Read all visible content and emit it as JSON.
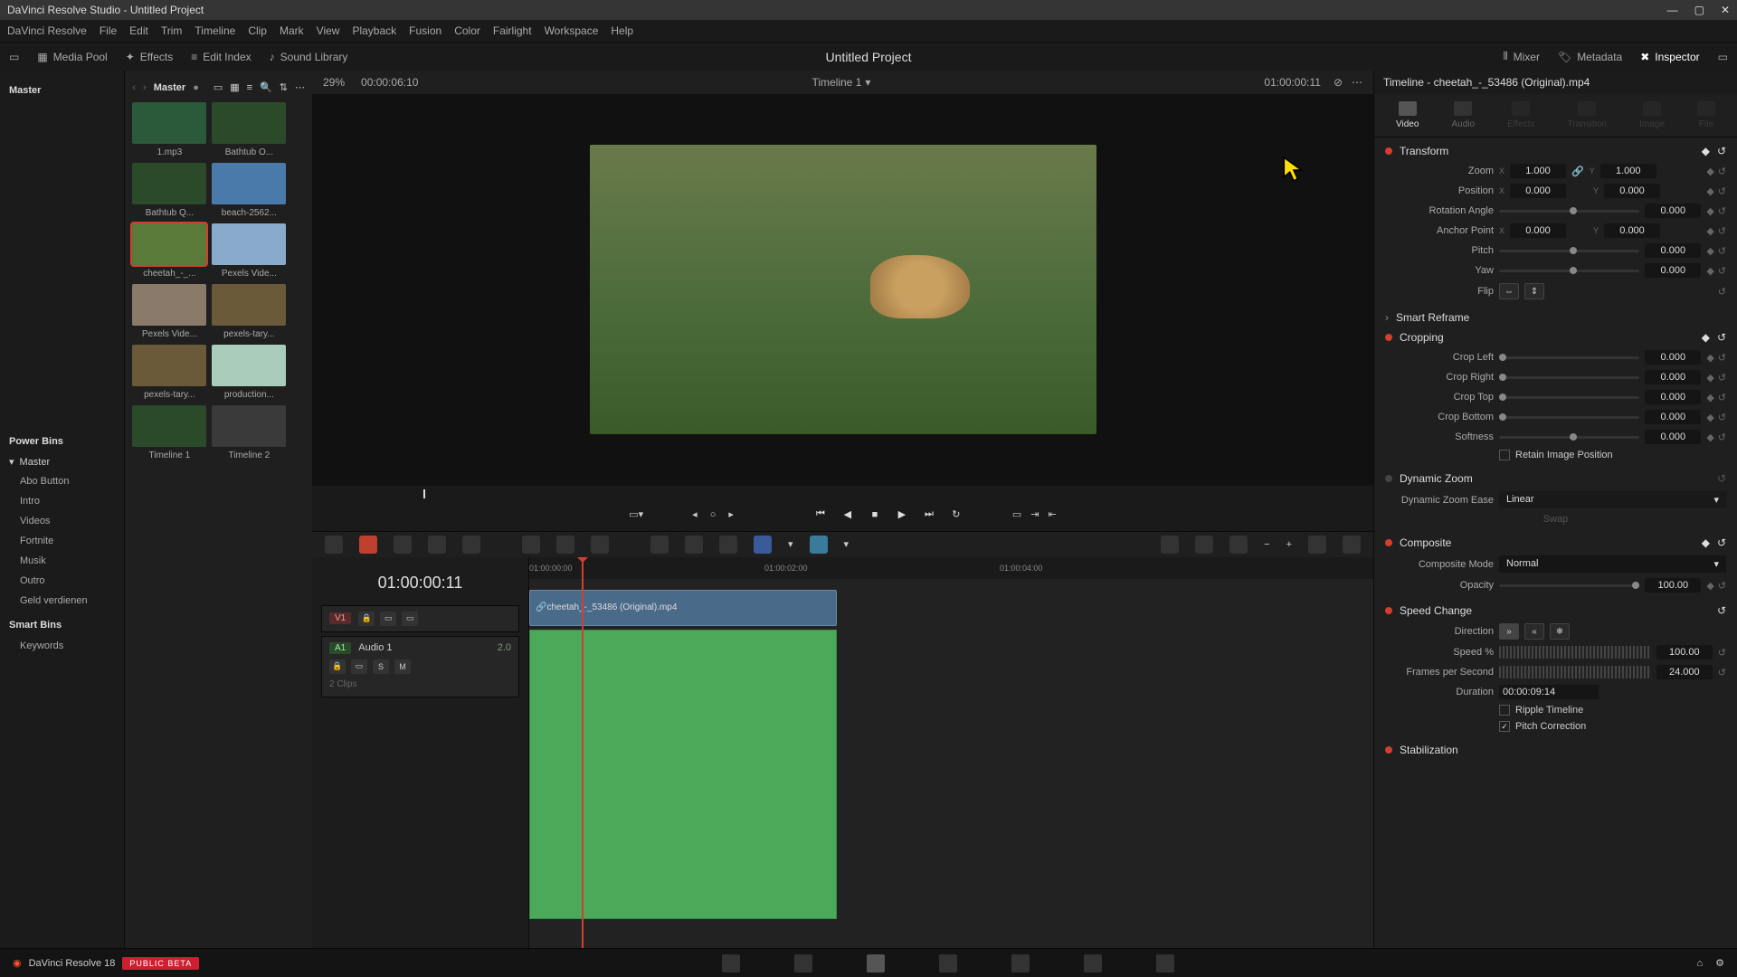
{
  "window": {
    "title": "DaVinci Resolve Studio - Untitled Project"
  },
  "menu": [
    "DaVinci Resolve",
    "File",
    "Edit",
    "Trim",
    "Timeline",
    "Clip",
    "Mark",
    "View",
    "Playback",
    "Fusion",
    "Color",
    "Fairlight",
    "Workspace",
    "Help"
  ],
  "toolbar": {
    "mediaPool": "Media Pool",
    "effects": "Effects",
    "editIndex": "Edit Index",
    "soundLibrary": "Sound Library",
    "projectTitle": "Untitled Project",
    "mixer": "Mixer",
    "metadata": "Metadata",
    "inspector": "Inspector"
  },
  "mediaPool": {
    "root": "Master",
    "breadcrumb": "Master",
    "clips": [
      {
        "name": "1.mp3",
        "sel": false,
        "hue": "#2a5a3a"
      },
      {
        "name": "Bathtub O...",
        "sel": false,
        "hue": "#2a4a2a"
      },
      {
        "name": "Bathtub Q...",
        "sel": false,
        "hue": "#2a4a2a"
      },
      {
        "name": "beach-2562...",
        "sel": false,
        "hue": "#4a7aaa"
      },
      {
        "name": "cheetah_-_...",
        "sel": true,
        "hue": "#5a7a3a"
      },
      {
        "name": "Pexels Vide...",
        "sel": false,
        "hue": "#8aaacc"
      },
      {
        "name": "Pexels Vide...",
        "sel": false,
        "hue": "#8a7a6a"
      },
      {
        "name": "pexels-tary...",
        "sel": false,
        "hue": "#6a5a3a"
      },
      {
        "name": "pexels-tary...",
        "sel": false,
        "hue": "#6a5a3a"
      },
      {
        "name": "production...",
        "sel": false,
        "hue": "#aaccbb"
      },
      {
        "name": "Timeline 1",
        "sel": false,
        "hue": "#2a4a2a"
      },
      {
        "name": "Timeline 2",
        "sel": false,
        "hue": "#3a3a3a"
      }
    ]
  },
  "bins": {
    "powerTitle": "Power Bins",
    "smartTitle": "Smart Bins",
    "master": "Master",
    "items": [
      "Abo Button",
      "Intro",
      "Videos",
      "Fortnite",
      "Musik",
      "Outro",
      "Geld verdienen"
    ],
    "smart": [
      "Keywords"
    ]
  },
  "viewer": {
    "zoom": "29%",
    "srcTC": "00:00:06:10",
    "timelineName": "Timeline 1",
    "recTC": "01:00:00:11"
  },
  "timeline": {
    "tc": "01:00:00:11",
    "ticks": [
      "01:00:00:00",
      "01:00:02:00",
      "01:00:04:00"
    ],
    "vTrack": "V1",
    "aTrack": "A1",
    "aLabel": "Audio 1",
    "aMeter": "2.0",
    "clipsLabel": "2 Clips",
    "clipName": "cheetah_-_53486 (Original).mp4"
  },
  "inspector": {
    "header": "Timeline - cheetah_-_53486 (Original).mp4",
    "tabs": [
      "Video",
      "Audio",
      "Effects",
      "Transition",
      "Image",
      "File"
    ],
    "transform": {
      "title": "Transform",
      "zoom": {
        "label": "Zoom",
        "x": "1.000",
        "y": "1.000"
      },
      "position": {
        "label": "Position",
        "x": "0.000",
        "y": "0.000"
      },
      "rotation": {
        "label": "Rotation Angle",
        "val": "0.000"
      },
      "anchor": {
        "label": "Anchor Point",
        "x": "0.000",
        "y": "0.000"
      },
      "pitch": {
        "label": "Pitch",
        "val": "0.000"
      },
      "yaw": {
        "label": "Yaw",
        "val": "0.000"
      },
      "flip": "Flip"
    },
    "smartReframe": "Smart Reframe",
    "cropping": {
      "title": "Cropping",
      "left": {
        "label": "Crop Left",
        "val": "0.000"
      },
      "right": {
        "label": "Crop Right",
        "val": "0.000"
      },
      "top": {
        "label": "Crop Top",
        "val": "0.000"
      },
      "bottom": {
        "label": "Crop Bottom",
        "val": "0.000"
      },
      "softness": {
        "label": "Softness",
        "val": "0.000"
      },
      "retain": "Retain Image Position"
    },
    "dynamicZoom": {
      "title": "Dynamic Zoom",
      "ease": "Dynamic Zoom Ease",
      "easeVal": "Linear",
      "swap": "Swap"
    },
    "composite": {
      "title": "Composite",
      "mode": "Composite Mode",
      "modeVal": "Normal",
      "opacity": "Opacity",
      "opacityVal": "100.00"
    },
    "speed": {
      "title": "Speed Change",
      "direction": "Direction",
      "speed": "Speed %",
      "speedVal": "100.00",
      "fps": "Frames per Second",
      "fpsVal": "24.000",
      "duration": "Duration",
      "durationVal": "00:00:09:14",
      "ripple": "Ripple Timeline",
      "pitch": "Pitch Correction"
    },
    "stabilization": "Stabilization"
  },
  "bottom": {
    "app": "DaVinci Resolve 18",
    "badge": "PUBLIC BETA"
  }
}
